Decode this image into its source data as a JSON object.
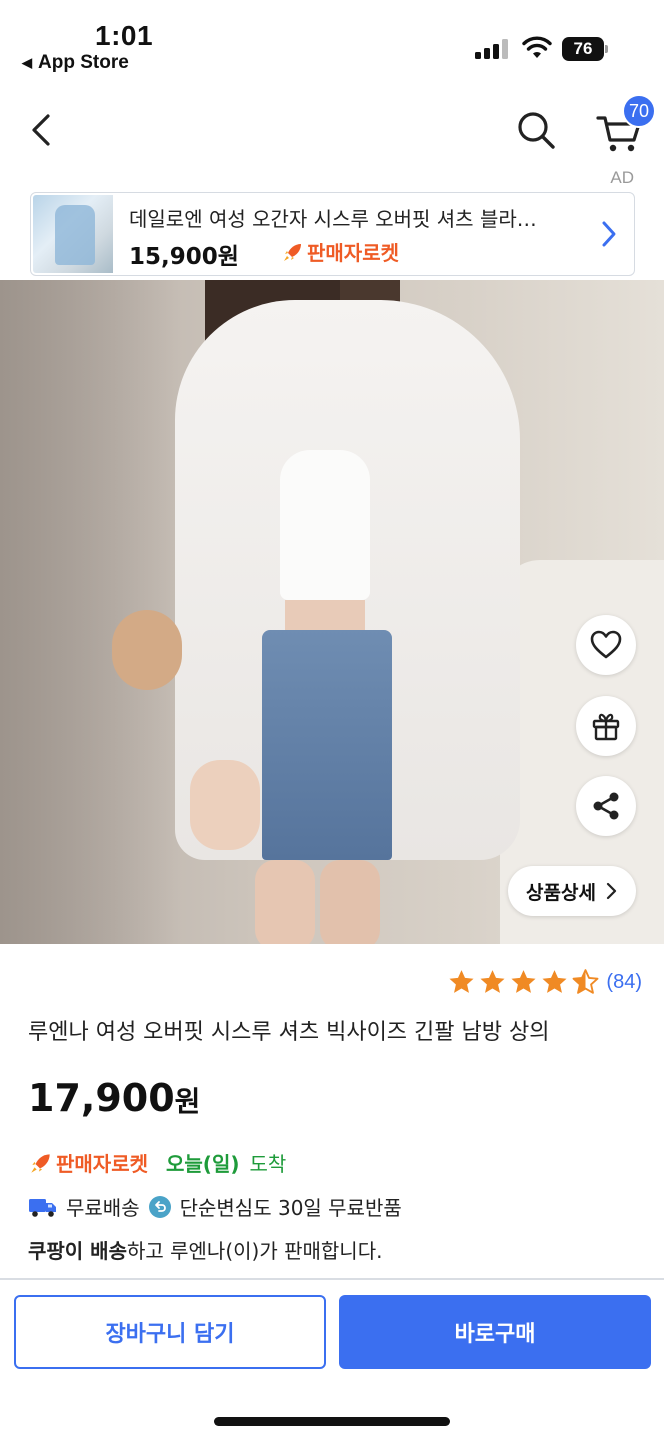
{
  "status_bar": {
    "time": "1:01",
    "back_app": "App Store",
    "battery": "76"
  },
  "header": {
    "cart_count": "70",
    "ad_label": "AD"
  },
  "ad_banner": {
    "title": "데일로엔 여성 오간자 시스루 오버핏 셔츠 블라…",
    "price": "15,900원",
    "badge": "판매자로켓"
  },
  "product": {
    "detail_button": "상품상세",
    "rating_count": "(84)",
    "rating_value": 4.5,
    "title": "루엔나 여성 오버핏 시스루 셔츠 빅사이즈 긴팔 남방 상의",
    "price_number": "17,900",
    "price_unit": "원",
    "rocket_badge": "판매자로켓",
    "arrival_day": "오늘(일)",
    "arrival_text": "도착",
    "free_shipping": "무료배송",
    "free_return": "단순변심도 30일 무료반품",
    "seller_bold": "쿠팡이 배송",
    "seller_rest": "하고 루엔나(이)가 판매합니다."
  },
  "actions": {
    "add_to_cart": "장바구니 담기",
    "buy_now": "바로구매"
  },
  "colors": {
    "accent": "#3b6ff0",
    "rocket": "#ef5b25",
    "arrival": "#1e9b3a",
    "star": "#f08a24"
  }
}
